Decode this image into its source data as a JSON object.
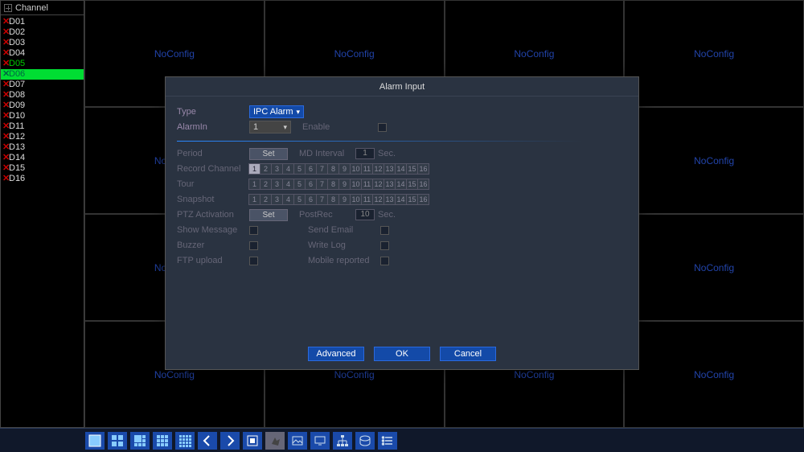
{
  "channel_panel": {
    "header": "Channel",
    "items": [
      {
        "id": "D01"
      },
      {
        "id": "D02"
      },
      {
        "id": "D03"
      },
      {
        "id": "D04"
      },
      {
        "id": "D05",
        "green": true
      },
      {
        "id": "D06",
        "active": true
      },
      {
        "id": "D07"
      },
      {
        "id": "D08"
      },
      {
        "id": "D09"
      },
      {
        "id": "D10"
      },
      {
        "id": "D11"
      },
      {
        "id": "D12"
      },
      {
        "id": "D13"
      },
      {
        "id": "D14"
      },
      {
        "id": "D15"
      },
      {
        "id": "D16"
      }
    ]
  },
  "grid": {
    "noconfig_label": "NoConfig"
  },
  "toolbar": {
    "icons": [
      "view1",
      "view4",
      "view8",
      "view9",
      "view16",
      "prev",
      "next",
      "fullscreen",
      "ptz",
      "image",
      "monitor",
      "network",
      "disk",
      "list"
    ]
  },
  "dialog": {
    "title": "Alarm Input",
    "type_label": "Type",
    "type_value": "IPC Alarm",
    "alarmin_label": "AlarmIn",
    "alarmin_value": "1",
    "enable_label": "Enable",
    "period_label": "Period",
    "set_label": "Set",
    "mdinterval_label": "MD Interval",
    "mdinterval_value": "1",
    "sec_label": "Sec.",
    "record_channel_label": "Record Channel",
    "tour_label": "Tour",
    "snapshot_label": "Snapshot",
    "ptz_label": "PTZ Activation",
    "postrec_label": "PostRec",
    "postrec_value": "10",
    "show_message_label": "Show Message",
    "send_email_label": "Send Email",
    "buzzer_label": "Buzzer",
    "write_log_label": "Write Log",
    "ftp_label": "FTP upload",
    "mobile_label": "Mobile reported",
    "numbers": [
      "1",
      "2",
      "3",
      "4",
      "5",
      "6",
      "7",
      "8",
      "9",
      "10",
      "11",
      "12",
      "13",
      "14",
      "15",
      "16"
    ],
    "buttons": {
      "advanced": "Advanced",
      "ok": "OK",
      "cancel": "Cancel"
    }
  }
}
